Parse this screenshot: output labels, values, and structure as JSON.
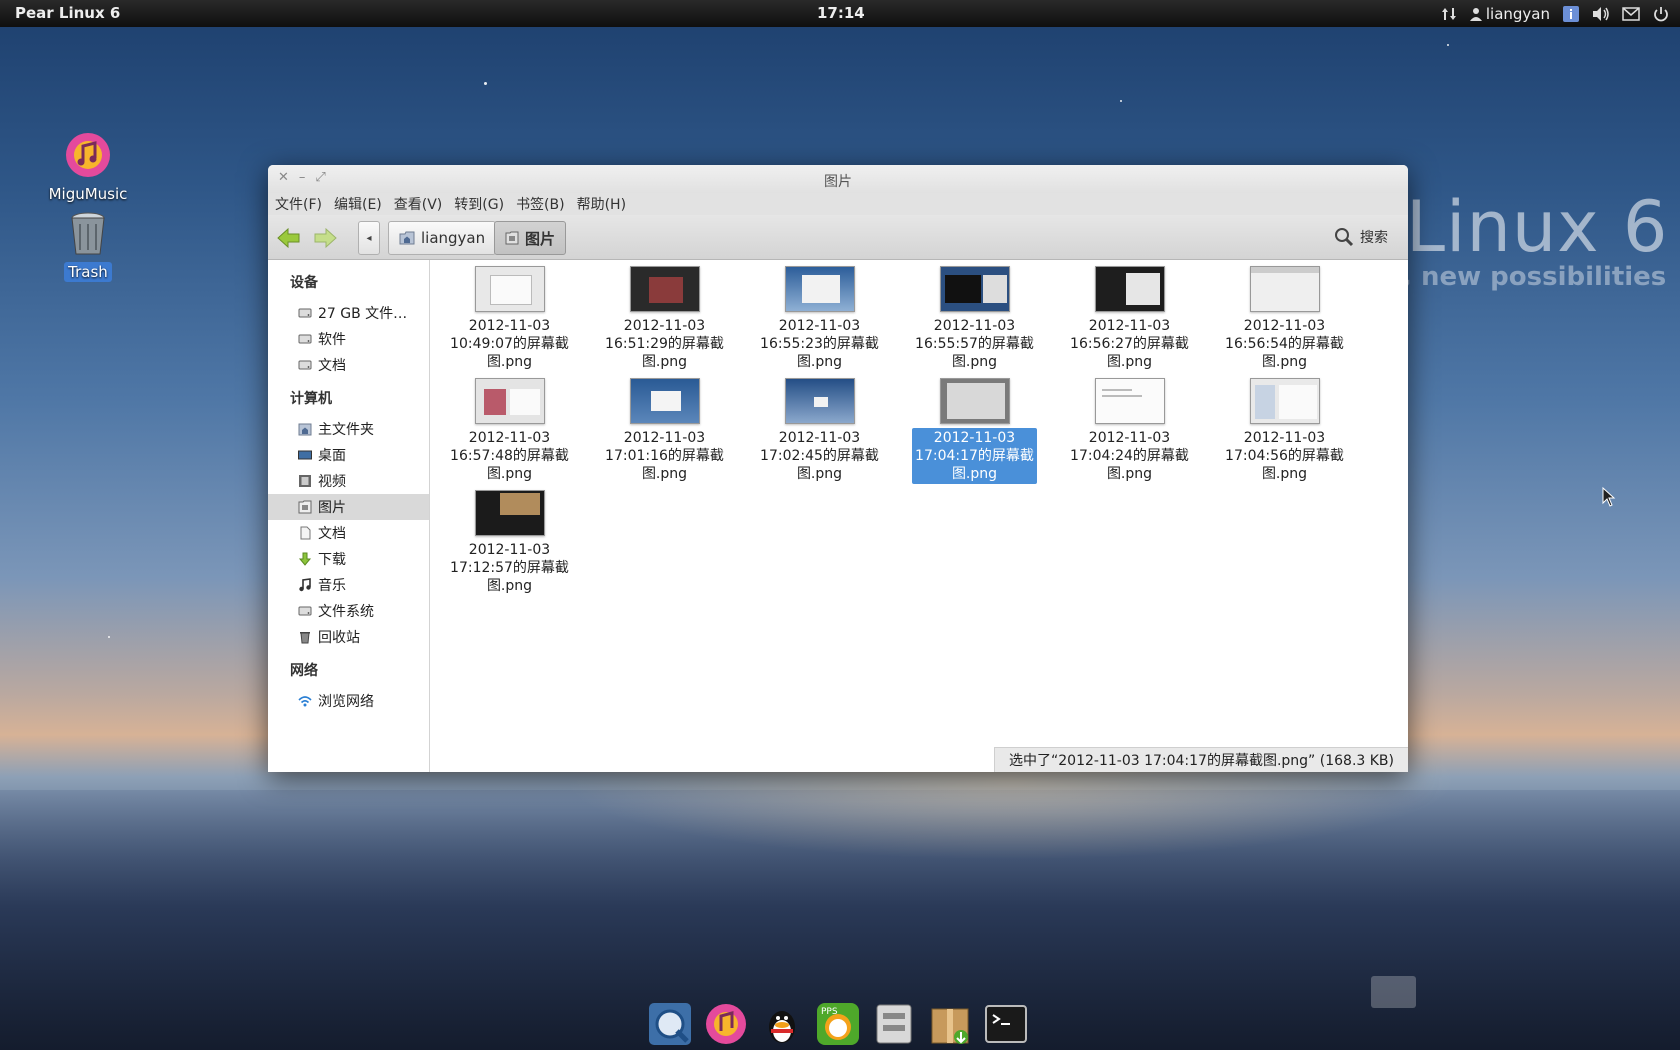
{
  "top_panel": {
    "distro_label": "Pear Linux 6",
    "clock": "17:14",
    "user": "liangyan"
  },
  "wallpaper": {
    "brand_title": "Linux 6",
    "brand_tagline": "new possibilities"
  },
  "desktop_icons": [
    {
      "label": "MiguMusic",
      "icon": "music-icon"
    },
    {
      "label": "Trash",
      "icon": "trash-icon"
    }
  ],
  "window": {
    "title": "图片",
    "menu": [
      "文件(F)",
      "编辑(E)",
      "查看(V)",
      "转到(G)",
      "书签(B)",
      "帮助(H)"
    ],
    "breadcrumbs": [
      "liangyan",
      "图片"
    ],
    "search_label": "搜索",
    "sidebar": {
      "devices_header": "设备",
      "devices": [
        "27 GB 文件…",
        "软件",
        "文档"
      ],
      "computer_header": "计算机",
      "computer": [
        "主文件夹",
        "桌面",
        "视频",
        "图片",
        "文档",
        "下载",
        "音乐",
        "文件系统",
        "回收站"
      ],
      "network_header": "网络",
      "network": [
        "浏览网络"
      ]
    },
    "files": [
      {
        "l1": "2012-11-03",
        "l2": "10:49:07的屏幕截",
        "l3": "图.png"
      },
      {
        "l1": "2012-11-03",
        "l2": "16:51:29的屏幕截",
        "l3": "图.png"
      },
      {
        "l1": "2012-11-03",
        "l2": "16:55:23的屏幕截",
        "l3": "图.png"
      },
      {
        "l1": "2012-11-03",
        "l2": "16:55:57的屏幕截",
        "l3": "图.png"
      },
      {
        "l1": "2012-11-03",
        "l2": "16:56:27的屏幕截",
        "l3": "图.png"
      },
      {
        "l1": "2012-11-03",
        "l2": "16:56:54的屏幕截",
        "l3": "图.png"
      },
      {
        "l1": "2012-11-03",
        "l2": "16:57:48的屏幕截",
        "l3": "图.png"
      },
      {
        "l1": "2012-11-03",
        "l2": "17:01:16的屏幕截",
        "l3": "图.png"
      },
      {
        "l1": "2012-11-03",
        "l2": "17:02:45的屏幕截",
        "l3": "图.png"
      },
      {
        "l1": "2012-11-03",
        "l2": "17:04:17的屏幕截",
        "l3": "图.png"
      },
      {
        "l1": "2012-11-03",
        "l2": "17:04:24的屏幕截",
        "l3": "图.png"
      },
      {
        "l1": "2012-11-03",
        "l2": "17:04:56的屏幕截",
        "l3": "图.png"
      },
      {
        "l1": "2012-11-03",
        "l2": "17:12:57的屏幕截",
        "l3": "图.png"
      }
    ],
    "status": "选中了“2012-11-03 17:04:17的屏幕截图.png” (168.3 KB)"
  },
  "dock": [
    "browser-icon",
    "music-icon",
    "qq-icon",
    "pps-icon",
    "files-icon",
    "package-icon",
    "terminal-icon"
  ]
}
